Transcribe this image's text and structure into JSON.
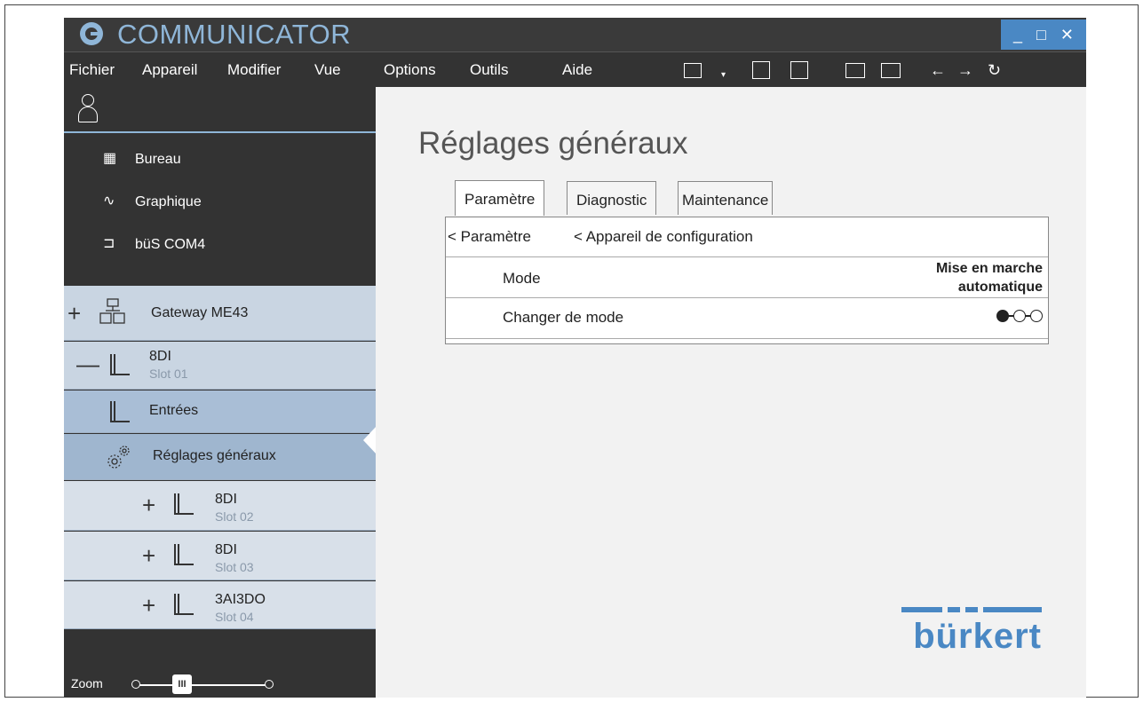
{
  "app": {
    "title": "COMMUNICATOR",
    "accent": "#4a88c4",
    "logo_color": "#8fb6d8"
  },
  "window_controls": {
    "minimize": "_",
    "maximize": "□",
    "close": "✕"
  },
  "menu": [
    "Fichier",
    "Appareil",
    "Modifier",
    "Vue",
    "Options",
    "Outils",
    "Aide"
  ],
  "toolbar": [
    "open-device-icon",
    "dropdown-icon",
    "save-icon",
    "save-as-icon",
    "upload-icon",
    "download-icon",
    "back-arrow-icon",
    "forward-arrow-icon",
    "refresh-icon"
  ],
  "sidebar": {
    "nav": [
      {
        "label": "Bureau",
        "icon": "desktop-icon"
      },
      {
        "label": "Graphique",
        "icon": "graph-icon"
      },
      {
        "label": "büS COM4",
        "icon": "bus-port-icon"
      }
    ],
    "tree": [
      {
        "sign": "+",
        "title": "Gateway ME43",
        "sub": "",
        "icon": "gateway-icon"
      },
      {
        "sign": "—",
        "title": "8DI",
        "sub": "Slot 01",
        "icon": "io-module-icon"
      },
      {
        "sign": "",
        "title": "Entrées",
        "sub": "",
        "icon": "io-module-icon"
      },
      {
        "sign": "",
        "title": "Réglages généraux",
        "sub": "",
        "icon": "gears-icon"
      },
      {
        "sign": "+",
        "title": "8DI",
        "sub": "Slot 02",
        "icon": "io-module-icon"
      },
      {
        "sign": "+",
        "title": "8DI",
        "sub": "Slot 03",
        "icon": "io-module-icon"
      },
      {
        "sign": "+",
        "title": "3AI3DO",
        "sub": "Slot 04",
        "icon": "io-module-icon"
      }
    ],
    "zoom_label": "Zoom",
    "zoom_thumb": "III"
  },
  "main": {
    "title": "Réglages généraux",
    "tabs": [
      "Paramètre",
      "Diagnostic",
      "Maintenance"
    ],
    "breadcrumb": [
      "< Paramètre",
      "< Appareil de configuration"
    ],
    "rows": [
      {
        "label": "Mode",
        "value_line1": "Mise en marche",
        "value_line2": "automatique"
      },
      {
        "label": "Changer de mode"
      }
    ],
    "brand": "bürkert"
  }
}
